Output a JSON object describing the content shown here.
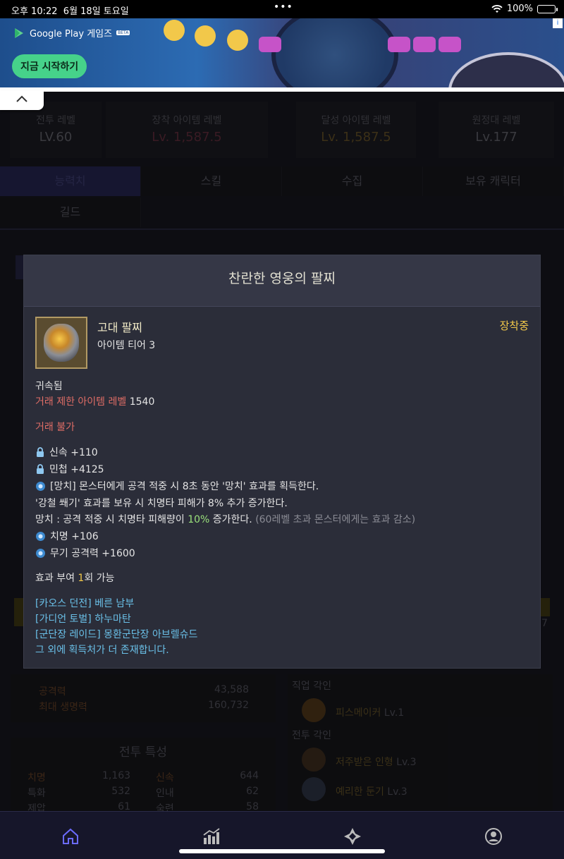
{
  "statusbar": {
    "time": "오후 10:22",
    "date": "6월 18일 토요일",
    "dots": "•••",
    "battery": "100%",
    "battery_level": 1.0
  },
  "ad": {
    "brand": "Google Play 게임즈",
    "beta": "BETA",
    "cta": "지금 시작하기",
    "info": "i"
  },
  "levels": [
    {
      "label": "전투 레벨",
      "value": "LV.60"
    },
    {
      "label": "장착 아이템 레벨",
      "value": "Lv. 1,587.5"
    },
    {
      "label": "달성 아이템 레벨",
      "value": "Lv. 1,587.5"
    },
    {
      "label": "원정대 레벨",
      "value": "Lv.177"
    }
  ],
  "tabs": [
    "능력치",
    "스킬",
    "수집",
    "보유 캐릭터",
    "길드"
  ],
  "stats": {
    "attack_label": "공격력",
    "attack": "43,588",
    "hp_label": "최대 생명력",
    "hp": "160,732",
    "combat_title": "전투 특성",
    "rows": [
      {
        "a": "치명",
        "av": "1,163",
        "b": "신속",
        "bv": "644"
      },
      {
        "a": "특화",
        "av": "532",
        "b": "인내",
        "bv": "62"
      },
      {
        "a": "제압",
        "av": "61",
        "b": "숙련",
        "bv": "58"
      }
    ]
  },
  "engravings": {
    "job_title": "직업 각인",
    "job": [
      {
        "name": "피스메이커",
        "level": "Lv.1"
      }
    ],
    "combat_title": "전투 각인",
    "combat": [
      {
        "name": "저주받은 인형",
        "level": "Lv.3"
      },
      {
        "name": "예리한 둔기",
        "level": "Lv.3"
      }
    ]
  },
  "side_number": "7",
  "modal": {
    "title": "찬란한 영웅의 팔찌",
    "item_name": "고대 팔찌",
    "item_tier": "아이템 티어 3",
    "equipped": "장착중",
    "bound": "귀속됨",
    "trade_limit_label": "거래 제한 아이템 레벨",
    "trade_limit_value": "1540",
    "untradeable": "거래 불가",
    "stat1": "신속 +110",
    "stat2": "민첩 +4125",
    "effect1": "[망치] 몬스터에게 공격 적중 시 8초 동안 '망치' 효과를 획득한다.",
    "effect2": "'강철 쐐기' 효과를 보유 시 치명타 피해가 8% 추가 증가한다.",
    "effect3_a": "망치 : 공격 적중 시 치명타 피해량이 ",
    "effect3_b": "10%",
    "effect3_c": " 증가한다. ",
    "effect3_d": "(60레벨 초과 몬스터에게는 효과 감소)",
    "stat3": "치명 +106",
    "stat4": "무기 공격력 +1600",
    "grant_a": "효과 부여 ",
    "grant_b": "1",
    "grant_c": "회 가능",
    "sources": [
      "[카오스 던전] 베른 남부",
      "[가디언 토벌] 하누마탄",
      "[군단장 레이드] 몽환군단장 아브렐슈드",
      "그 외에 획득처가 더 존재합니다."
    ]
  },
  "colors": {
    "trade_red": "#e06d66",
    "highlight_green": "#9be27c",
    "equipped_yellow": "#f3c94a",
    "source_link": "#6ac0e8",
    "nav_active": "#6b6bff"
  },
  "nav": [
    "home-icon",
    "stats-icon",
    "compass-icon",
    "profile-icon"
  ]
}
